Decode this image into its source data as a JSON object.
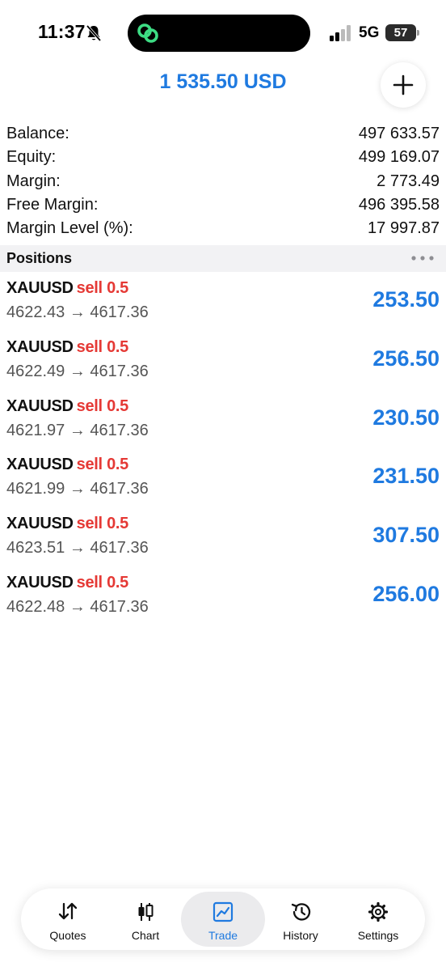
{
  "status_bar": {
    "time": "11:37",
    "network": "5G",
    "battery": "57"
  },
  "header": {
    "total": "1 535.50 USD",
    "add_icon": "plus-icon"
  },
  "account": [
    {
      "label": "Balance:",
      "value": "497 633.57"
    },
    {
      "label": "Equity:",
      "value": "499 169.07"
    },
    {
      "label": "Margin:",
      "value": "2 773.49"
    },
    {
      "label": "Free Margin:",
      "value": "496 395.58"
    },
    {
      "label": "Margin Level (%):",
      "value": "17 997.87"
    }
  ],
  "positions": {
    "title": "Positions",
    "items": [
      {
        "symbol": "XAUUSD",
        "side": "sell 0.5",
        "prices": "4622.43 → 4617.36",
        "profit": "253.50"
      },
      {
        "symbol": "XAUUSD",
        "side": "sell 0.5",
        "prices": "4622.49 → 4617.36",
        "profit": "256.50"
      },
      {
        "symbol": "XAUUSD",
        "side": "sell 0.5",
        "prices": "4621.97 → 4617.36",
        "profit": "230.50"
      },
      {
        "symbol": "XAUUSD",
        "side": "sell 0.5",
        "prices": "4621.99 → 4617.36",
        "profit": "231.50"
      },
      {
        "symbol": "XAUUSD",
        "side": "sell 0.5",
        "prices": "4623.51 → 4617.36",
        "profit": "307.50"
      },
      {
        "symbol": "XAUUSD",
        "side": "sell 0.5",
        "prices": "4622.48 → 4617.36",
        "profit": "256.00"
      }
    ]
  },
  "tabs": [
    {
      "label": "Quotes",
      "icon": "quotes-arrows-icon",
      "active": false
    },
    {
      "label": "Chart",
      "icon": "candlestick-icon",
      "active": false
    },
    {
      "label": "Trade",
      "icon": "trade-chart-icon",
      "active": true
    },
    {
      "label": "History",
      "icon": "history-clock-icon",
      "active": false
    },
    {
      "label": "Settings",
      "icon": "gear-icon",
      "active": false
    }
  ],
  "colors": {
    "accent": "#1f7ae0",
    "sell": "#e53935"
  }
}
